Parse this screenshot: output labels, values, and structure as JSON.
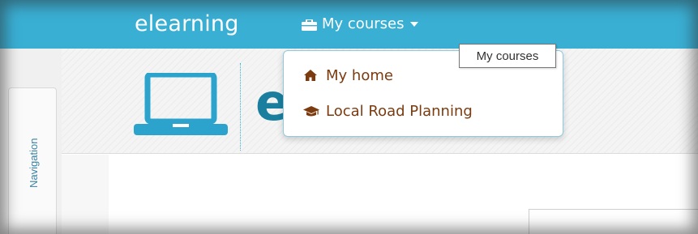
{
  "navbar": {
    "brand": "elearning",
    "menu_label": "My courses",
    "menu_icon": "briefcase-icon",
    "accent_color": "#3aafd4"
  },
  "dropdown": {
    "items": [
      {
        "label": "My home",
        "icon": "home-icon"
      },
      {
        "label": "Local Road Planning",
        "icon": "graduation-cap-icon"
      }
    ],
    "item_color": "#7b3b0f"
  },
  "tooltip": {
    "text": "My courses"
  },
  "header": {
    "site_initial": "e",
    "logo_icon": "laptop-icon"
  },
  "sidebar": {
    "tab_label": "Navigation"
  }
}
